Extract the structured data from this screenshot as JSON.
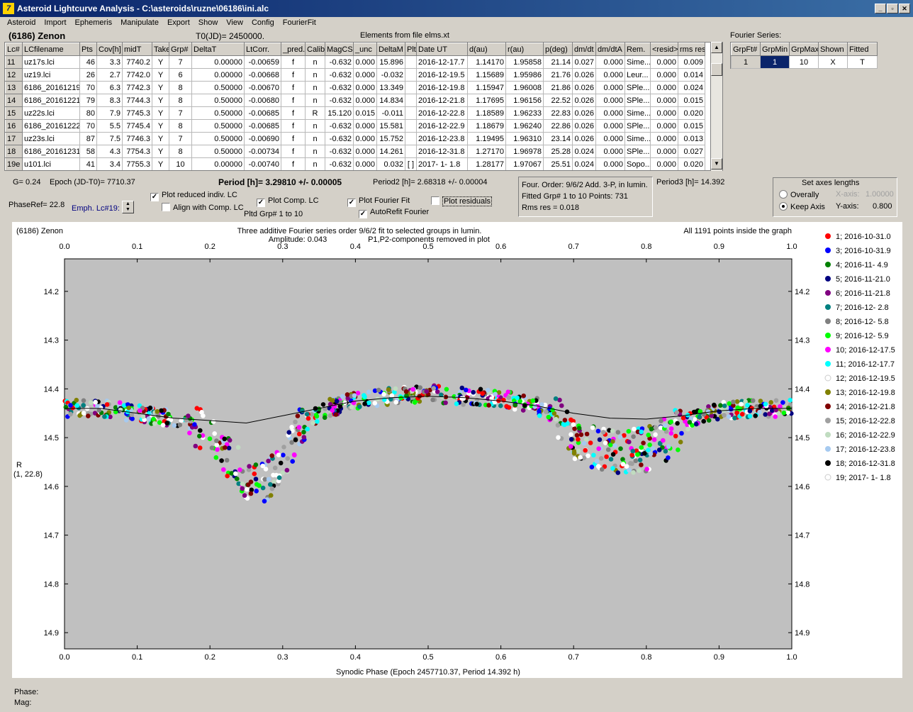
{
  "window": {
    "title": "Asteroid Lightcurve Analysis - C:\\asteroids\\ruzne\\06186\\ini.alc",
    "icon_label": "7"
  },
  "menu": [
    "Asteroid",
    "Import",
    "Ephemeris",
    "Manipulate",
    "Export",
    "Show",
    "View",
    "Config",
    "FourierFit"
  ],
  "header": {
    "asteroid": "(6186) Zenon",
    "t0": "T0(JD)= 2450000.",
    "elements": "Elements from file elms.xt",
    "fourier_series": "Fourier Series:"
  },
  "lc_table": {
    "columns": [
      "Lc#",
      "LCfilename",
      "Pts",
      "Cov[h]",
      "midT",
      "Take",
      "Grp#",
      "DeltaT",
      "LtCorr.",
      "_pred.",
      "Calib",
      "MagCS",
      "_unc",
      "DeltaM",
      "Plt",
      "Date UT",
      "d(au)",
      "r(au)",
      "p(deg)",
      "dm/dt",
      "dm/dtA",
      "Rem.",
      "<resid>",
      "rms res"
    ],
    "rows": [
      [
        "11",
        "uz17s.lci",
        "46",
        "3.3",
        "7740.2",
        "Y",
        "7",
        "0.00000",
        "-0.00659",
        "f",
        "n",
        "-0.632",
        "0.000",
        "15.896",
        "",
        "2016-12-17.7",
        "1.14170",
        "1.95858",
        "21.14",
        "0.027",
        "0.000",
        "Sime...",
        "0.000",
        "0.009"
      ],
      [
        "12",
        "uz19.lci",
        "26",
        "2.7",
        "7742.0",
        "Y",
        "6",
        "0.00000",
        "-0.00668",
        "f",
        "n",
        "-0.632",
        "0.000",
        "-0.032",
        "",
        "2016-12-19.5",
        "1.15689",
        "1.95986",
        "21.76",
        "0.026",
        "0.000",
        "Leur...",
        "0.000",
        "0.014"
      ],
      [
        "13",
        "6186_20161219",
        "70",
        "6.3",
        "7742.3",
        "Y",
        "8",
        "0.50000",
        "-0.00670",
        "f",
        "n",
        "-0.632",
        "0.000",
        "13.349",
        "",
        "2016-12-19.8",
        "1.15947",
        "1.96008",
        "21.86",
        "0.026",
        "0.000",
        "SPle...",
        "0.000",
        "0.024"
      ],
      [
        "14",
        "6186_20161221",
        "79",
        "8.3",
        "7744.3",
        "Y",
        "8",
        "0.50000",
        "-0.00680",
        "f",
        "n",
        "-0.632",
        "0.000",
        "14.834",
        "",
        "2016-12-21.8",
        "1.17695",
        "1.96156",
        "22.52",
        "0.026",
        "0.000",
        "SPle...",
        "0.000",
        "0.015"
      ],
      [
        "15",
        "uz22s.lci",
        "80",
        "7.9",
        "7745.3",
        "Y",
        "7",
        "0.50000",
        "-0.00685",
        "f",
        "R",
        "15.120",
        "0.015",
        "-0.011",
        "",
        "2016-12-22.8",
        "1.18589",
        "1.96233",
        "22.83",
        "0.026",
        "0.000",
        "Sime...",
        "0.000",
        "0.020"
      ],
      [
        "16",
        "6186_20161222",
        "70",
        "5.5",
        "7745.4",
        "Y",
        "8",
        "0.50000",
        "-0.00685",
        "f",
        "n",
        "-0.632",
        "0.000",
        "15.581",
        "",
        "2016-12-22.9",
        "1.18679",
        "1.96240",
        "22.86",
        "0.026",
        "0.000",
        "SPle...",
        "0.000",
        "0.015"
      ],
      [
        "17",
        "uz23s.lci",
        "87",
        "7.5",
        "7746.3",
        "Y",
        "7",
        "0.50000",
        "-0.00690",
        "f",
        "n",
        "-0.632",
        "0.000",
        "15.752",
        "",
        "2016-12-23.8",
        "1.19495",
        "1.96310",
        "23.14",
        "0.026",
        "0.000",
        "Sime...",
        "0.000",
        "0.013"
      ],
      [
        "18",
        "6186_20161231",
        "58",
        "4.3",
        "7754.3",
        "Y",
        "8",
        "0.50000",
        "-0.00734",
        "f",
        "n",
        "-0.632",
        "0.000",
        "14.261",
        "",
        "2016-12-31.8",
        "1.27170",
        "1.96978",
        "25.28",
        "0.024",
        "0.000",
        "SPle...",
        "0.000",
        "0.027"
      ],
      [
        "19e",
        "u101.lci",
        "41",
        "3.4",
        "7755.3",
        "Y",
        "10",
        "0.00000",
        "-0.00740",
        "f",
        "n",
        "-0.632",
        "0.000",
        "0.032",
        "[ ]",
        "2017- 1- 1.8",
        "1.28177",
        "1.97067",
        "25.51",
        "0.024",
        "0.000",
        "Sopo...",
        "0.000",
        "0.020"
      ]
    ]
  },
  "fourier_table": {
    "columns": [
      "GrpFt#",
      "GrpMin",
      "GrpMax",
      "Shown",
      "Fitted"
    ],
    "row": [
      "1",
      "1",
      "10",
      "X",
      "T"
    ]
  },
  "controls": {
    "g": "G= 0.24",
    "epoch": "Epoch (JD-T0)= 7710.37",
    "period": "Period [h]= 3.29810 +/- 0.00005",
    "period2": "Period2 [h]= 2.68318 +/- 0.00004",
    "phaseref": "PhaseRef= 22.8",
    "emph": "Emph. Lc#19:",
    "plot_reduced": "Plot reduced indiv. LC",
    "align": "Align with Comp. LC",
    "plot_comp": "Plot Comp. LC",
    "pltd_grp": "Pltd Grp#  1   to   10",
    "plot_fourier": "Plot Fourier Fit",
    "autorefit": "AutoRefit Fourier",
    "plot_residuals": "Plot residuals",
    "four_order": "Four. Order:  9/6/2   Add. 3-P,  in lumin.",
    "fitted_grp": "Fitted Grp# 1 to 10   Points: 731",
    "rms": "Rms res     = 0.018",
    "period3": "Period3 [h]= 14.392",
    "axes_title": "Set axes lengths",
    "overally": "Overally",
    "keep_axis": "Keep Axis",
    "x_axis_label": "X-axis:",
    "x_axis_val": "1.00000",
    "y_axis_label": "Y-axis:",
    "y_axis_val": "0.800"
  },
  "status": {
    "phase": "Phase:",
    "mag": "Mag:"
  },
  "chart_data": {
    "type": "scatter",
    "title_left": "(6186) Zenon",
    "title": "Three additive Fourier series order 9/6/2 fit to selected groups in lumin.",
    "subtitle": "Amplitude: 0.043",
    "subtitle2": "P1,P2-components removed in plot",
    "note_right": "All 1191 points inside the graph",
    "xlabel": "Synodic Phase (Epoch 2457710.37, Period 14.392 h)",
    "ylabel": "R",
    "ylabel2": "(1, 22.8)",
    "xlim": [
      0,
      1
    ],
    "ylim": [
      14.35,
      14.95
    ],
    "y_inverted": true,
    "xticks": [
      "0.0",
      "0.1",
      "0.2",
      "0.3",
      "0.4",
      "0.5",
      "0.6",
      "0.7",
      "0.8",
      "0.9",
      "1.0"
    ],
    "yticks": [
      "14.2",
      "14.3",
      "14.4",
      "14.5",
      "14.6",
      "14.7",
      "14.8",
      "14.9"
    ],
    "ytick_values": [
      14.2,
      14.3,
      14.4,
      14.5,
      14.6,
      14.7,
      14.8,
      14.9
    ],
    "legend": [
      {
        "name": "1; 2016-10-31.0",
        "color": "#ff0000"
      },
      {
        "name": "3; 2016-10-31.9",
        "color": "#0000ff"
      },
      {
        "name": "4; 2016-11- 4.9",
        "color": "#008000"
      },
      {
        "name": "5; 2016-11-21.0",
        "color": "#000080"
      },
      {
        "name": "6; 2016-11-21.8",
        "color": "#800080"
      },
      {
        "name": "7; 2016-12- 2.8",
        "color": "#008080"
      },
      {
        "name": "8; 2016-12- 5.8",
        "color": "#808080"
      },
      {
        "name": "9; 2016-12- 5.9",
        "color": "#00ff00"
      },
      {
        "name": "10; 2016-12-17.5",
        "color": "#ff00ff"
      },
      {
        "name": "11; 2016-12-17.7",
        "color": "#00ffff"
      },
      {
        "name": "12; 2016-12-19.5",
        "color": "#ffffff"
      },
      {
        "name": "13; 2016-12-19.8",
        "color": "#808000"
      },
      {
        "name": "14; 2016-12-21.8",
        "color": "#800000"
      },
      {
        "name": "15; 2016-12-22.8",
        "color": "#a0a0a0"
      },
      {
        "name": "16; 2016-12-22.9",
        "color": "#c0dcc0"
      },
      {
        "name": "17; 2016-12-23.8",
        "color": "#a6caf0"
      },
      {
        "name": "18; 2016-12-31.8",
        "color": "#000000"
      },
      {
        "name": "19; 2017- 1- 1.8",
        "color": "#ffffff"
      }
    ],
    "fit_curve": {
      "x": [
        0.0,
        0.05,
        0.1,
        0.15,
        0.2,
        0.25,
        0.3,
        0.35,
        0.4,
        0.45,
        0.5,
        0.55,
        0.6,
        0.65,
        0.7,
        0.75,
        0.8,
        0.85,
        0.9,
        0.95,
        1.0
      ],
      "y": [
        14.44,
        14.44,
        14.45,
        14.46,
        14.465,
        14.47,
        14.455,
        14.44,
        14.425,
        14.418,
        14.415,
        14.418,
        14.425,
        14.435,
        14.45,
        14.46,
        14.462,
        14.455,
        14.445,
        14.44,
        14.44
      ]
    },
    "mean_curve": {
      "x": [
        0.0,
        0.05,
        0.1,
        0.15,
        0.2,
        0.22,
        0.25,
        0.27,
        0.3,
        0.33,
        0.36,
        0.4,
        0.45,
        0.5,
        0.55,
        0.6,
        0.65,
        0.68,
        0.7,
        0.73,
        0.76,
        0.8,
        0.83,
        0.86,
        0.9,
        0.95,
        1.0
      ],
      "y": [
        14.44,
        14.44,
        14.45,
        14.46,
        14.49,
        14.53,
        14.58,
        14.6,
        14.55,
        14.47,
        14.44,
        14.425,
        14.415,
        14.41,
        14.415,
        14.42,
        14.435,
        14.46,
        14.5,
        14.52,
        14.53,
        14.525,
        14.5,
        14.465,
        14.445,
        14.44,
        14.44
      ]
    }
  }
}
